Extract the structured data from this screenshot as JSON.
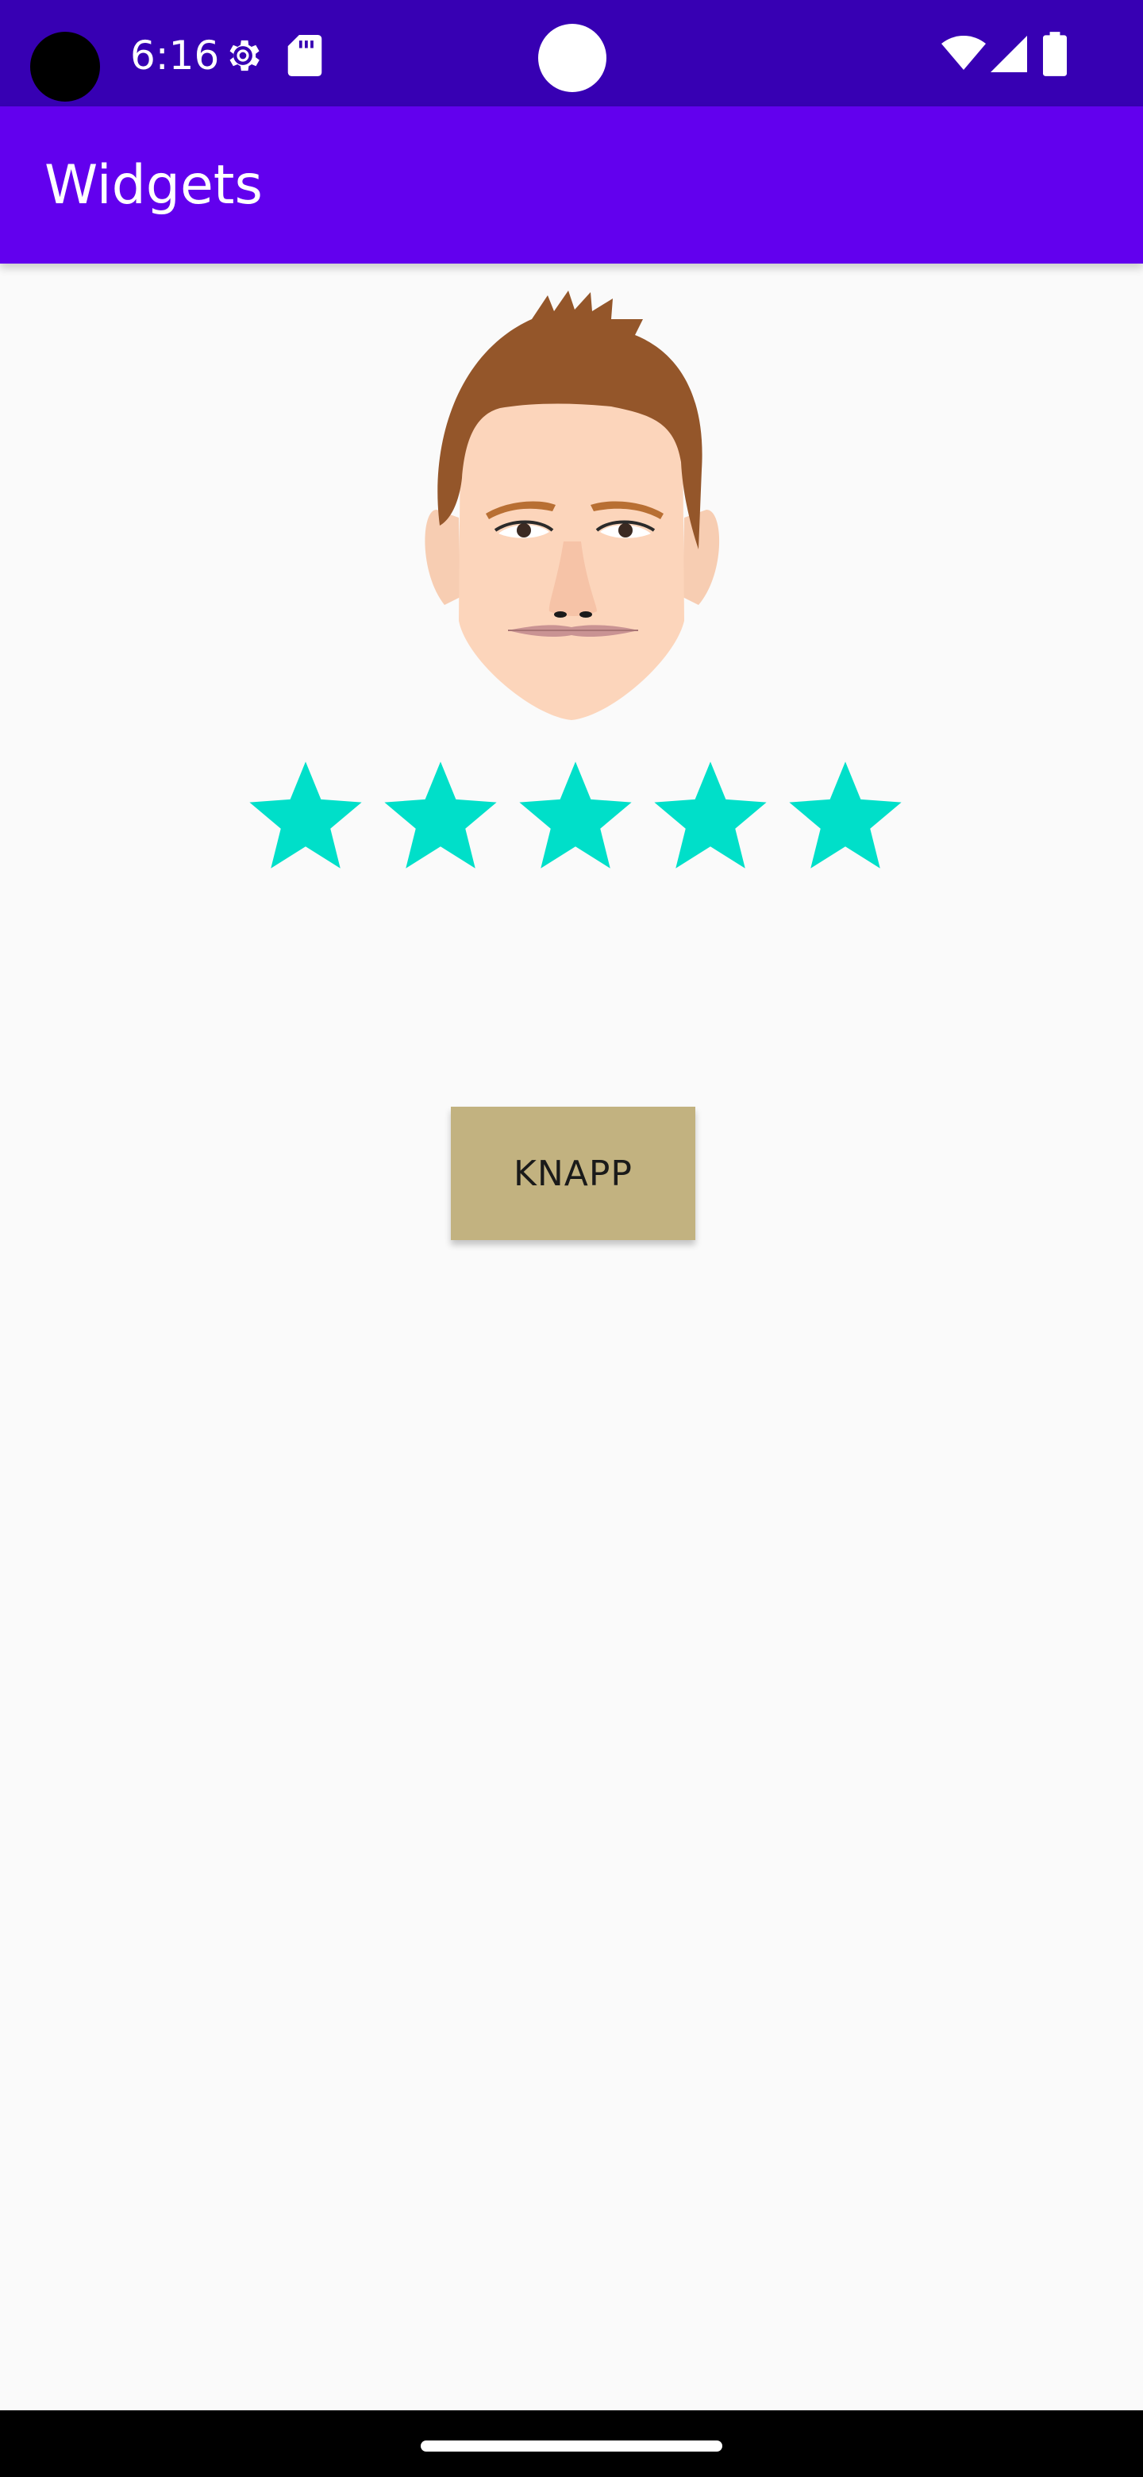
{
  "status_bar": {
    "time": "6:16",
    "icons": {
      "left": [
        "settings-gear-icon",
        "sd-card-icon"
      ],
      "right": [
        "wifi-icon",
        "cell-signal-icon",
        "battery-icon"
      ]
    }
  },
  "app_bar": {
    "title": "Widgets",
    "color": "#6200ee"
  },
  "avatar": {
    "icon": "face-avatar-icon"
  },
  "rating": {
    "value": 5,
    "max": 5,
    "star_color": "#00dfc9"
  },
  "button": {
    "label": "KNAPP",
    "color": "#c2b280"
  }
}
